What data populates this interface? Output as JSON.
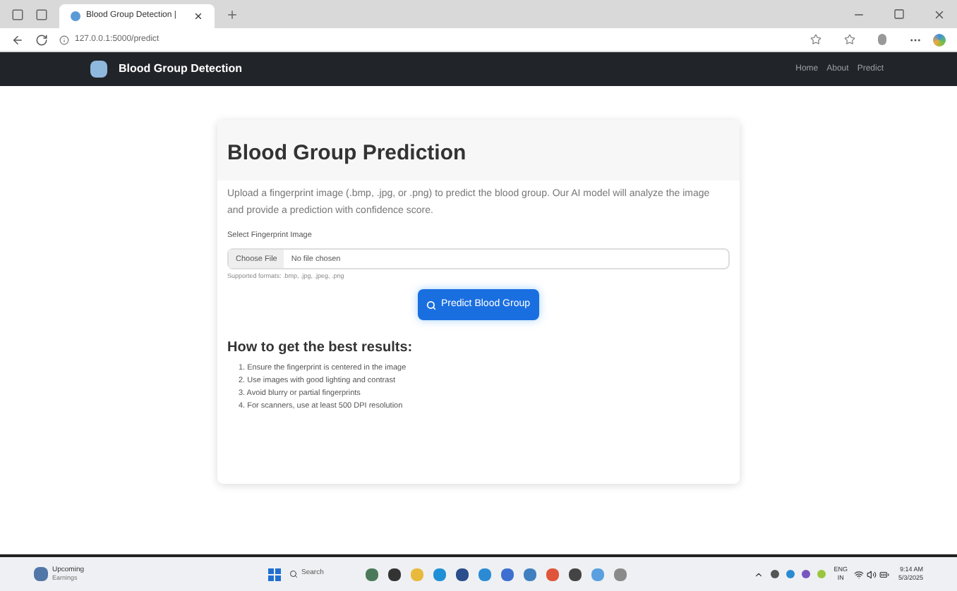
{
  "browser": {
    "tab_title": "Blood Group Detection |",
    "url": "127.0.0.1:5000/predict"
  },
  "navbar": {
    "brand": "Blood Group Detection",
    "links": [
      "Home",
      "About",
      "Predict"
    ]
  },
  "card": {
    "title": "Blood Group Prediction",
    "description": "Upload a fingerprint image (.bmp, .jpg, or .png) to predict the blood group. Our AI model will analyze the image and provide a prediction with confidence score.",
    "field_label": "Select Fingerprint Image",
    "file_button": "Choose File",
    "file_status": "No file chosen",
    "hint": "Supported formats: .bmp, .jpg, .jpeg, .png",
    "submit": "Predict Blood Group",
    "tips_title": "How to get the best results:",
    "tips": [
      "1. Ensure the fingerprint is centered in the image",
      "2. Use images with good lighting and contrast",
      "3. Avoid blurry or partial fingerprints",
      "4. For scanners, use at least 500 DPI resolution"
    ]
  },
  "taskbar": {
    "widget_title": "Upcoming",
    "widget_subtitle": "Earnings",
    "search": "Search",
    "language": "ENG",
    "region": "IN",
    "time": "9:14 AM",
    "date": "5/3/2025"
  }
}
